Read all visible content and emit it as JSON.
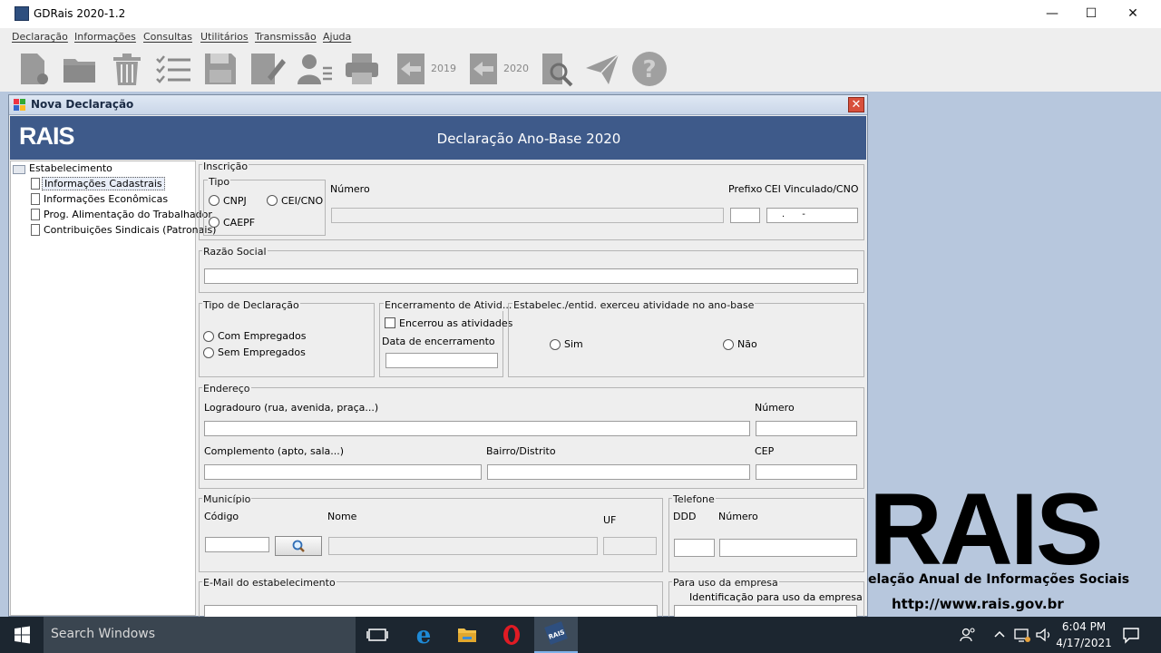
{
  "window": {
    "title": "GDRais 2020-1.2",
    "minimize": "—",
    "maximize": "☐",
    "close": "✕"
  },
  "menu": [
    "Declaração",
    "Informações",
    "Consultas",
    "Utilitários",
    "Transmissão",
    "Ajuda"
  ],
  "toolbar": {
    "prev_year_label": "2019",
    "curr_year_label": "2020"
  },
  "frame": {
    "title": "Nova Declaração",
    "close": "✕"
  },
  "banner": {
    "logo": "RAIS",
    "title": "Declaração Ano-Base 2020"
  },
  "tree": {
    "root": "Estabelecimento",
    "items": [
      "Informações Cadastrais",
      "Informações Econômicas",
      "Prog. Alimentação do Trabalhador",
      "Contribuições Sindicais (Patronais)"
    ]
  },
  "inscricao": {
    "group": "Inscrição",
    "tipo_group": "Tipo",
    "options": [
      "CNPJ",
      "CEI/CNO",
      "CAEPF"
    ],
    "numero_label": "Número",
    "prefixo_label": "Prefixo",
    "cei_label": "CEI Vinculado/CNO",
    "cei_value": ".      -"
  },
  "razao": {
    "group": "Razão Social"
  },
  "tipo_decl": {
    "group": "Tipo de Declaração",
    "options": [
      "Com Empregados",
      "Sem Empregados"
    ]
  },
  "encerramento": {
    "group": "Encerramento de Ativid...",
    "checkbox": "Encerrou as atividades",
    "date_label": "Data de encerramento"
  },
  "exerceu": {
    "group": "Estabelec./entid. exerceu atividade no ano-base",
    "options": [
      "Sim",
      "Não"
    ]
  },
  "endereco": {
    "group": "Endereço",
    "logradouro": "Logradouro (rua, avenida, praça...)",
    "numero": "Número",
    "complemento": "Complemento (apto, sala...)",
    "bairro": "Bairro/Distrito",
    "cep": "CEP"
  },
  "municipio": {
    "group": "Município",
    "codigo": "Código",
    "nome": "Nome",
    "uf": "UF"
  },
  "telefone": {
    "group": "Telefone",
    "ddd": "DDD",
    "numero": "Número"
  },
  "email": {
    "group": "E-Mail do estabelecimento"
  },
  "uso_empresa": {
    "group": "Para uso da empresa",
    "ident": "Identificação para uso da empresa"
  },
  "background": {
    "logo": "RAIS",
    "subtitle": "elação Anual de Informações Sociais",
    "url": "http://www.rais.gov.br"
  },
  "taskbar": {
    "search_placeholder": "Search Windows",
    "time": "6:04 PM",
    "date": "4/17/2021"
  },
  "colors": {
    "banner": "#3e5a8a",
    "taskbar": "#1c2630",
    "desktop": "#b7c7dd"
  }
}
